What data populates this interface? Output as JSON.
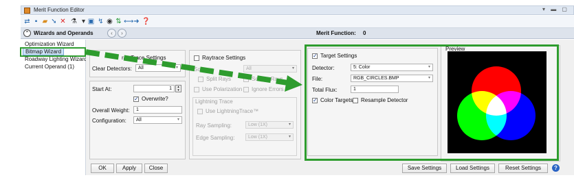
{
  "window": {
    "title": "Merit Function Editor",
    "controls": "▾ ▬ ▢"
  },
  "header": {
    "title": "Wizards and Operands",
    "merit_label": "Merit Function:",
    "merit_value": "0"
  },
  "operands": [
    "Optimization Wizard",
    "Bitmap Wizard",
    "Roadway Lighting Wizard",
    "Current Operand (1)"
  ],
  "left_panel": {
    "header_text": "ray Trace Settings",
    "clear_detectors_label": "Clear Detectors:",
    "clear_detectors_value": "All",
    "start_at_label": "Start At:",
    "start_at_value": "1",
    "overwrite_label": "Overwrite?",
    "overall_weight_label": "Overall Weight:",
    "overall_weight_value": "1",
    "configuration_label": "Configuration:",
    "configuration_value": "All"
  },
  "raytrace": {
    "raytrace_settings_label": "Raytrace Settings",
    "source_label": "Source:",
    "source_value": "All",
    "split_rays_label": "Split Rays",
    "scatter_rays_label": "Scatter Rays",
    "use_polarization_label": "Use Polarization",
    "ignore_errors_label": "Ignore Errors",
    "lightning_trace_label": "Lightning Trace",
    "use_lightning_label": "Use LightningTrace™",
    "ray_sampling_label": "Ray Sampling:",
    "ray_sampling_value": "Low (1X)",
    "edge_sampling_label": "Edge Sampling:",
    "edge_sampling_value": "Low (1X)"
  },
  "target": {
    "target_settings_label": "Target Settings",
    "detector_label": "Detector:",
    "detector_value": "5: Color",
    "file_label": "File:",
    "file_value": "RGB_CIRCLES.BMP",
    "total_flux_label": "Total Flux:",
    "total_flux_value": "1",
    "color_targets_label": "Color Targets",
    "resample_label": "Resample Detector"
  },
  "preview": {
    "label": "Preview",
    "circle_colors": [
      "#ff0000",
      "#00ff00",
      "#0000ff"
    ]
  },
  "buttons": {
    "ok": "OK",
    "apply": "Apply",
    "close": "Close",
    "save": "Save Settings",
    "load": "Load Settings",
    "reset": "Reset Settings"
  },
  "colors": {
    "highlight": "#2e9c2e",
    "selection": "#cde3f7"
  }
}
